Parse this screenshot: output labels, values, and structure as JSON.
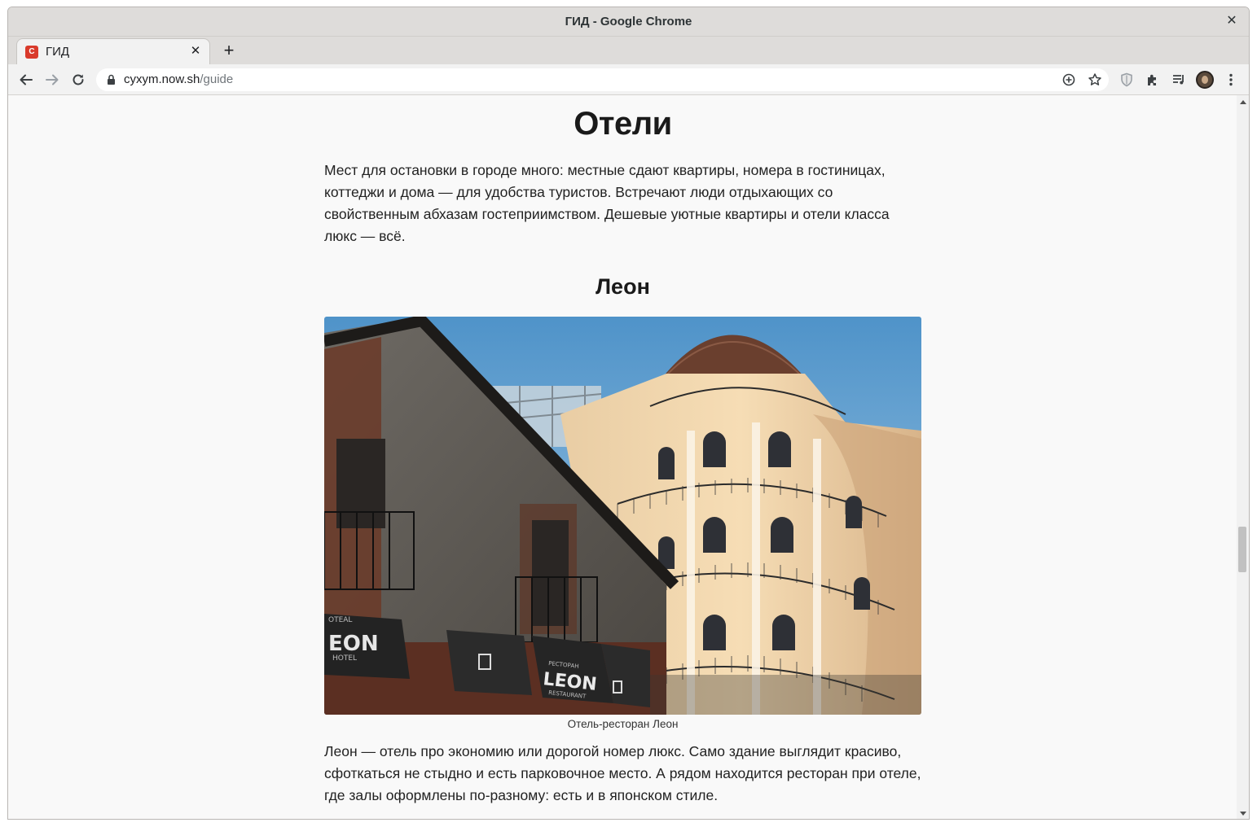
{
  "window": {
    "title": "ГИД - Google Chrome",
    "close_glyph": "✕"
  },
  "tab": {
    "favicon_letter": "С",
    "title": "ГИД",
    "close_glyph": "✕"
  },
  "newtab_glyph": "+",
  "omnibox": {
    "host": "cyxym.now.sh",
    "path": "/guide"
  },
  "article": {
    "heading": "Отели",
    "intro": "Мест для остановки в городе много: местные сдают квартиры, номера в гостиницах, коттеджи и дома — для удобства туристов. Встречают люди отдыхающих со свойственным абхазам гостеприимством. Дешевые уютные квартиры и отели класса люкс — всё.",
    "subheading": "Леон",
    "image": {
      "caption": "Отель-ресторан Леон",
      "awning_left": "EON",
      "awning_left_top": "OTEAL",
      "awning_left_bottom": "HOTEL",
      "awning_right": "LEON",
      "awning_right_top": "РЕСТОРАН",
      "awning_right_bottom": "RESTAURANT"
    },
    "body": "Леон — отель про экономию или дорогой номер люкс. Само здание выглядит красиво, сфоткаться не стыдно и есть парковочное место. А рядом находится ресторан при отеле, где залы оформлены по-разному: есть и в японском стиле."
  },
  "icons": [
    "back-icon",
    "forward-icon",
    "reload-icon",
    "lock-icon",
    "add-icon",
    "star-icon",
    "shield-icon",
    "extensions-icon",
    "media-icon",
    "avatar",
    "menu-icon"
  ]
}
